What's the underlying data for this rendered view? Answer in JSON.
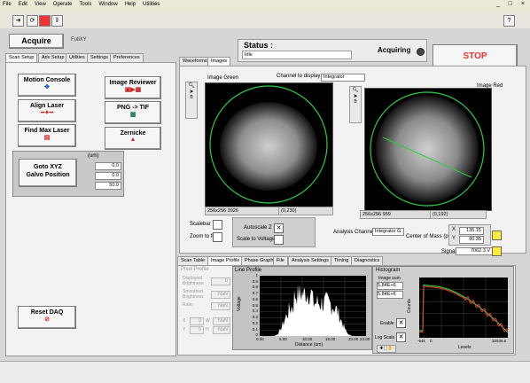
{
  "menu": [
    "File",
    "Edit",
    "View",
    "Operate",
    "Tools",
    "Window",
    "Help",
    "Utilities"
  ],
  "window_buttons": [
    "_",
    "□",
    "×"
  ],
  "toolbar": {
    "run_icon": "run-arrow-icon",
    "question": "?"
  },
  "acquire": {
    "label": "Acquire",
    "mode_value": "FullXY"
  },
  "left_tabs": [
    "Scan Setup",
    "Adv Setup",
    "Utilities",
    "Settings",
    "Preferences"
  ],
  "buttons": {
    "motion_console": "Motion Console",
    "image_reviewer": "Image Reviewer",
    "align_laser": "Align Laser",
    "png_tif": "PNG -> TIF",
    "find_max_laser": "Find Max Laser",
    "zernicke": "Zernicke",
    "goto_xyz": "Goto XYZ\nGalvo Position",
    "reset_daq": "Reset DAQ"
  },
  "goto": {
    "units": "(um)",
    "x": "0.0",
    "y": "0.0",
    "z": "50.0"
  },
  "status": {
    "title": "Status :",
    "value": "Idle",
    "acquiring": "Acquiring",
    "stop": "STOP"
  },
  "right_tabs": [
    "Waveforms",
    "Images"
  ],
  "channel": {
    "label": "Channel to display",
    "value": "Integrator"
  },
  "image_green": {
    "title": "Image Green",
    "info": "256x256 3926",
    "coords": "(0,230)"
  },
  "image_red": {
    "title": "Image Red",
    "info": "256x256 959",
    "coords": "(0,192)"
  },
  "controls": {
    "scalebar": "Scalebar",
    "zoom_to_fit": "Zoom to fit",
    "autoscale_z": "Autoscale Z",
    "scale_to_voltage": "Scale to Voltage",
    "analysis_channel": "Analysis Channel",
    "analysis_channel_value": "Integrator G",
    "center_of_mass": "Center of Mass (pixels)",
    "com_x_label": "X",
    "com_x": "135.15",
    "com_y_label": "Y",
    "com_y": "90.35",
    "signal_label": "Signal",
    "signal_value": "7062.3 V"
  },
  "bottom_tabs": [
    "Scan Table",
    "Image Profile",
    "Phase Graph",
    "File",
    "Analysis Settings",
    "Timing",
    "Diagnostics"
  ],
  "pixel_profile": {
    "title": "Pixel Profile",
    "displayed": "Displayed Brightness",
    "smoothed": "Smoothed Brightness",
    "ratio": "Ratio",
    "nan": "NaN",
    "zero": "0",
    "x": "X",
    "y": "Y",
    "w": "W",
    "h": "H"
  },
  "line_profile": {
    "title": "Line Profile",
    "ylabel": "Voltage",
    "xlabel": "Distance (um)",
    "yticks": [
      "1",
      "0.9",
      "0.8",
      "0.7",
      "0.6",
      "0.5",
      "0.4",
      "0.3",
      "0.2",
      "0.1",
      "0"
    ],
    "xticks": [
      "0.00",
      "5.00",
      "10.00",
      "15.00",
      "20.00",
      "23.00"
    ]
  },
  "histogram": {
    "title": "Histogram",
    "image_sum": "Image sum",
    "sum1": "5.84E+6",
    "sum2": "5.84E+6",
    "enable": "Enable",
    "log_scale": "Log Scale",
    "ylabel": "Counts",
    "xlabel": "Levels",
    "xticks": [
      "-64k",
      "0",
      "32536.5"
    ]
  },
  "colors": {
    "accent_green": "#2ecc40",
    "stop_red": "#ee2222"
  }
}
